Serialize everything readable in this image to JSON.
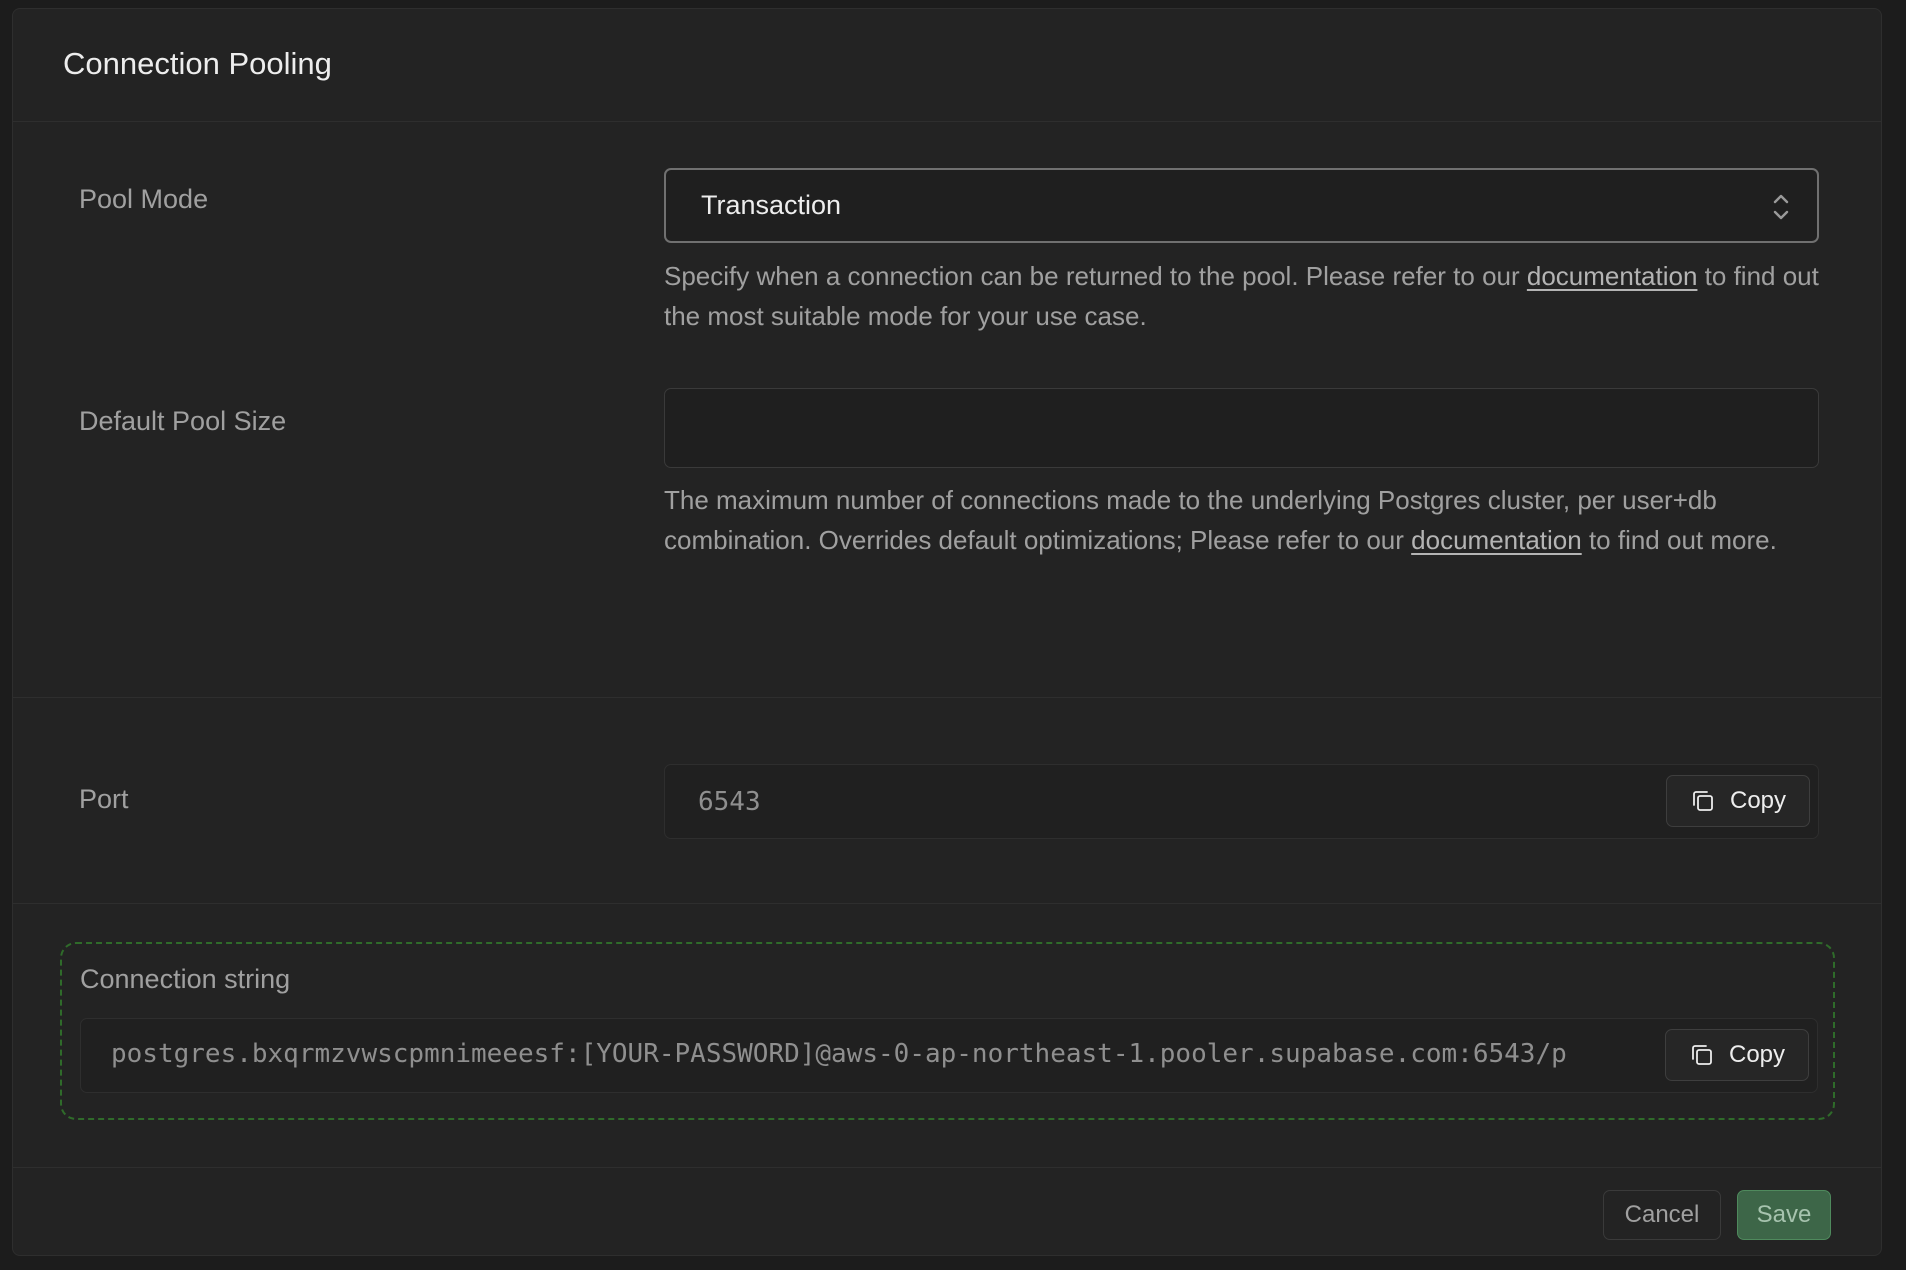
{
  "panel": {
    "title": "Connection Pooling"
  },
  "pool_mode": {
    "label": "Pool Mode",
    "value": "Transaction",
    "help_before": "Specify when a connection can be returned to the pool. Please refer to our ",
    "help_link": "documentation",
    "help_after": " to find out the most suitable mode for your use case."
  },
  "default_pool_size": {
    "label": "Default Pool Size",
    "value": "",
    "placeholder": "",
    "help_before": "The maximum number of connections made to the underlying Postgres cluster, per user+db combination. Overrides default optimizations; Please refer to our ",
    "help_link": "documentation",
    "help_after": " to find out more."
  },
  "port": {
    "label": "Port",
    "value": "6543",
    "copy_label": "Copy"
  },
  "connection_string": {
    "label": "Connection string",
    "value": "postgres.bxqrmzvwscpmnimeeesf:[YOUR-PASSWORD]@aws-0-ap-northeast-1.pooler.supabase.com:6543/p",
    "copy_label": "Copy"
  },
  "footer": {
    "cancel_label": "Cancel",
    "save_label": "Save"
  },
  "colors": {
    "panel_bg": "#232323",
    "dashed_border": "#2f6b2a",
    "save_bg": "#3d6648"
  }
}
